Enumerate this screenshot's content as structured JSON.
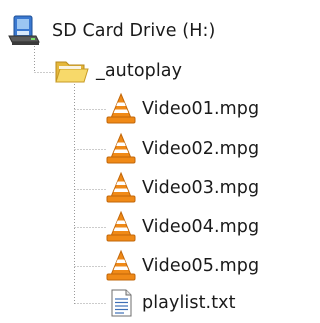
{
  "tree": {
    "root": {
      "label": "SD Card Drive (H:)",
      "icon": "sd-card-drive-icon"
    },
    "folder": {
      "label": "_autoplay",
      "icon": "open-folder-icon"
    },
    "files": [
      {
        "label": "Video01.mpg",
        "icon": "vlc-cone-icon"
      },
      {
        "label": "Video02.mpg",
        "icon": "vlc-cone-icon"
      },
      {
        "label": "Video03.mpg",
        "icon": "vlc-cone-icon"
      },
      {
        "label": "Video04.mpg",
        "icon": "vlc-cone-icon"
      },
      {
        "label": "Video05.mpg",
        "icon": "vlc-cone-icon"
      },
      {
        "label": "playlist.txt",
        "icon": "text-file-icon"
      }
    ]
  },
  "colors": {
    "tree_line": "#9a9a9a",
    "vlc_orange": "#f08a17",
    "vlc_white": "#ffffff",
    "folder_yellow": "#f2cf55",
    "drive_blue": "#2f6fc7"
  }
}
